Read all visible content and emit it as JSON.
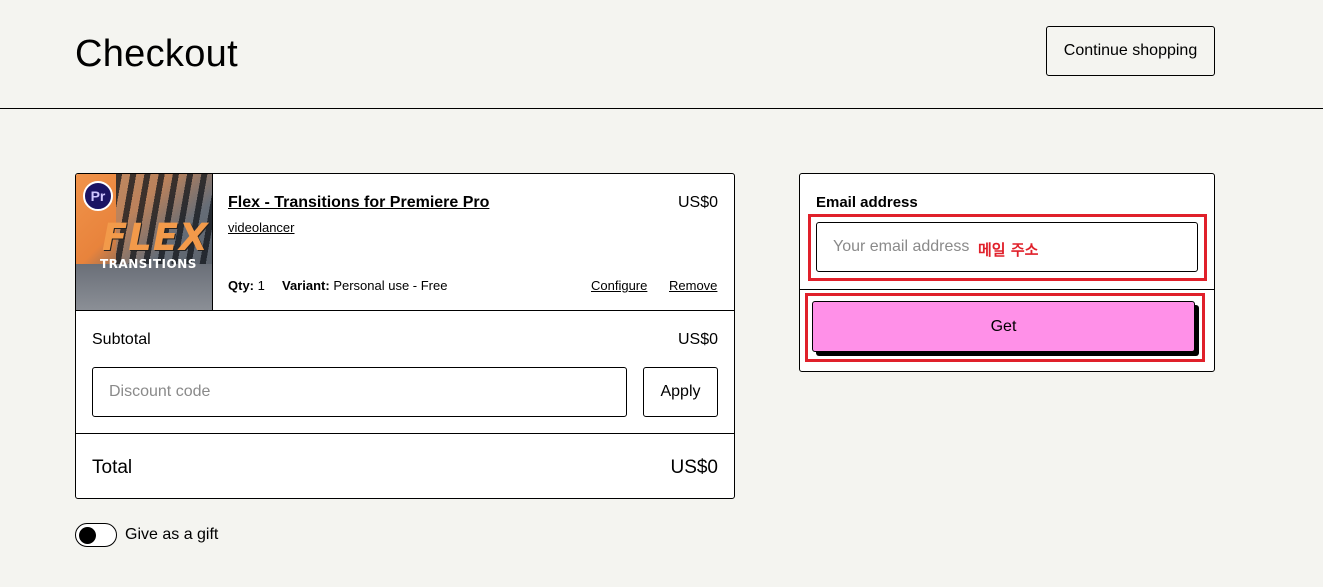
{
  "header": {
    "title": "Checkout",
    "continue_label": "Continue shopping"
  },
  "cart": {
    "item": {
      "thumb_badge": "Pr",
      "thumb_title": "FLEX",
      "thumb_subtitle": "TRANSITIONS",
      "title": "Flex - Transitions for Premiere Pro",
      "author": "videolancer",
      "price": "US$0",
      "qty_label": "Qty:",
      "qty_value": "1",
      "variant_label": "Variant:",
      "variant_value": "Personal use - Free",
      "configure_label": "Configure",
      "remove_label": "Remove"
    },
    "subtotal_label": "Subtotal",
    "subtotal_value": "US$0",
    "discount_placeholder": "Discount code",
    "apply_label": "Apply",
    "total_label": "Total",
    "total_value": "US$0"
  },
  "gift": {
    "label": "Give as a gift",
    "enabled": false
  },
  "email_form": {
    "label": "Email address",
    "placeholder": "Your email address",
    "annotation": "메일 주소",
    "get_label": "Get"
  },
  "colors": {
    "background": "#f4f4f0",
    "accent_pink": "#ff90e8",
    "highlight_red": "#e0202a"
  }
}
